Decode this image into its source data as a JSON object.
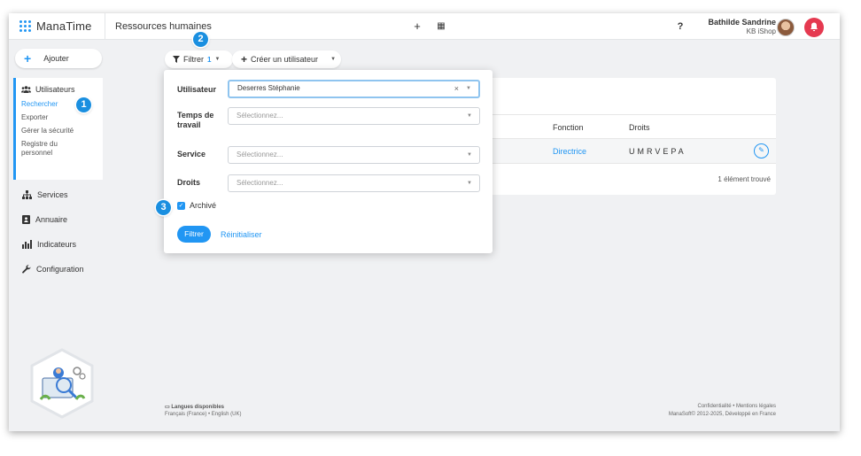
{
  "app": {
    "logo_text": "ManaTime",
    "section_title": "Ressources humaines",
    "user_name": "Bathilde Sandrine",
    "user_company": "KB iShop",
    "help_label": "?",
    "add_glyph": "+",
    "calendar_glyph": "▦"
  },
  "sidebar": {
    "add_label": "Ajouter",
    "users": {
      "label": "Utilisateurs",
      "subitems": [
        {
          "label": "Rechercher",
          "active": true
        },
        {
          "label": "Exporter"
        },
        {
          "label": "Gérer la sécurité"
        },
        {
          "label": "Registre du personnel"
        }
      ]
    },
    "items": [
      {
        "label": "Services",
        "icon": "org-chart-icon"
      },
      {
        "label": "Annuaire",
        "icon": "address-book-icon"
      },
      {
        "label": "Indicateurs",
        "icon": "bar-chart-icon"
      },
      {
        "label": "Configuration",
        "icon": "wrench-icon"
      }
    ]
  },
  "toolbar": {
    "filter_label": "Filtrer",
    "filter_count": "1",
    "create_label": "Créer un utilisateur"
  },
  "filter_panel": {
    "user_label": "Utilisateur",
    "user_value": "Deserres Stéphanie",
    "clear_glyph": "×",
    "time_label": "Temps de travail",
    "time_placeholder": "Sélectionnez...",
    "service_label": "Service",
    "service_placeholder": "Sélectionnez...",
    "rights_label": "Droits",
    "rights_placeholder": "Sélectionnez...",
    "archived_label": "Archivé",
    "archived_checked": true,
    "apply_label": "Filtrer",
    "reset_label": "Réinitialiser"
  },
  "results": {
    "columns": [
      "Fonction",
      "Droits"
    ],
    "rows": [
      {
        "fonction": "Directrice",
        "droits": "UMRVEPA"
      }
    ],
    "count_text": "1 élément trouvé"
  },
  "footer": {
    "languages_title": "Langues disponibles",
    "languages": "Français (France) • English (UK)",
    "links": "Confidentialité • Mentions légales",
    "copyright": "ManaSoft© 2012-2025, Développé en France"
  },
  "markers": [
    "1",
    "2",
    "3"
  ],
  "colors": {
    "accent": "#2196f3",
    "alert": "#e53950",
    "marker": "#1a8fe0"
  }
}
